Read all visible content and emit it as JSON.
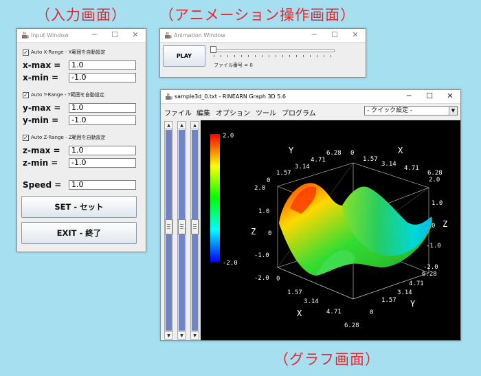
{
  "captions": {
    "input": "（入力画面）",
    "animation": "（アニメーション操作画面）",
    "graph": "（グラフ画面）"
  },
  "input_window": {
    "title": "Input Window",
    "x_range": {
      "auto_checked": true,
      "auto_label": "Auto X-Range - X範囲を自動設定",
      "max_label": "x-max =",
      "max_value": "1.0",
      "min_label": "x-min =",
      "min_value": "-1.0"
    },
    "y_range": {
      "auto_checked": true,
      "auto_label": "Auto Y-Range - Y範囲を自動設定",
      "max_label": "y-max =",
      "max_value": "1.0",
      "min_label": "y-min =",
      "min_value": "-1.0"
    },
    "z_range": {
      "auto_checked": true,
      "auto_label": "Auto Z-Range - Z範囲を自動設定",
      "max_label": "z-max =",
      "max_value": "1.0",
      "min_label": "z-min =",
      "min_value": "-1.0"
    },
    "speed_label": "Speed =",
    "speed_value": "1.0",
    "set_button": "SET - セット",
    "exit_button": "EXIT - 終了"
  },
  "animation_window": {
    "title": "Animation Window",
    "play_button": "PLAY",
    "slider_value": 0,
    "file_number_label": "ファイル番号 = 0"
  },
  "graph_window": {
    "title": "sample3d_0.txt - RINEARN Graph 3D 5.6",
    "menu": [
      "ファイル",
      "編集",
      "オプション",
      "ツール",
      "プログラム"
    ],
    "quick_setting": "- クイック設定 -",
    "colorbar": {
      "max": "2.0",
      "min": "-2.0"
    },
    "axes": {
      "x_label": "X",
      "y_label": "Y",
      "z_label": "Z",
      "x_ticks": [
        "0",
        "1.57",
        "3.14",
        "4.71",
        "6.28"
      ],
      "y_ticks": [
        "0",
        "1.57",
        "3.14",
        "4.71",
        "6.28"
      ],
      "z_ticks": [
        "-2.0",
        "-1.0",
        "0",
        "1.0",
        "2.0"
      ]
    },
    "colors": {
      "plot_bg": "#000000",
      "scroll_track": "#6f85c8"
    }
  },
  "icons": {
    "app": "java-cup-icon",
    "minimize": "minimize-icon",
    "maximize": "maximize-icon",
    "close": "close-icon"
  }
}
